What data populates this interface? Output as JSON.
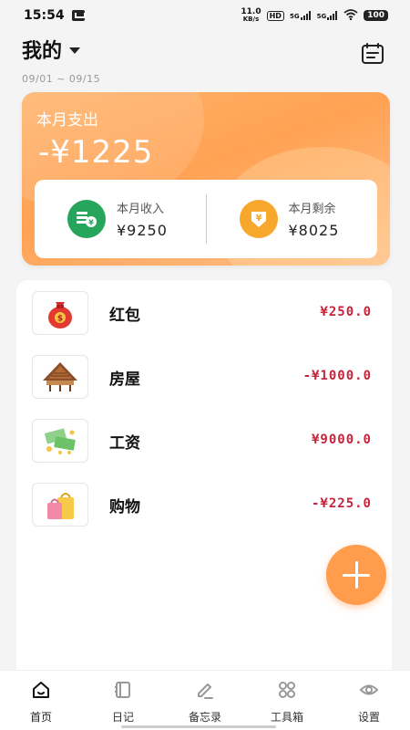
{
  "status_bar": {
    "time": "15:54",
    "network_speed": "11.0",
    "network_unit": "KB/s",
    "hd_badge": "HD",
    "signal1": "5G",
    "signal2": "5G",
    "battery": "100"
  },
  "header": {
    "title": "我的",
    "date_range": "09/01 ~ 09/15",
    "icons": [
      "chevron-down-icon",
      "calendar-icon"
    ]
  },
  "summary": {
    "expense_label": "本月支出",
    "expense_amount": "-¥1225",
    "income_label": "本月收入",
    "income_amount": "¥9250",
    "remaining_label": "本月剩余",
    "remaining_amount": "¥8025",
    "income_icon_glyph": "¥",
    "remaining_icon_glyph": "¥",
    "colors": {
      "card": "#ffa254",
      "income_icon": "#27a55d",
      "remaining_icon": "#f7a72c"
    }
  },
  "records": [
    {
      "name": "红包",
      "amount": "¥250.0",
      "icon": "red-envelope-icon"
    },
    {
      "name": "房屋",
      "amount": "-¥1000.0",
      "icon": "house-icon"
    },
    {
      "name": "工资",
      "amount": "¥9000.0",
      "icon": "money-icon"
    },
    {
      "name": "购物",
      "amount": "-¥225.0",
      "icon": "shopping-bag-icon"
    }
  ],
  "amount_color": "#c5243c",
  "fab": {
    "icon": "plus-icon",
    "color": "#ff9d4d"
  },
  "bottom_nav": [
    {
      "label": "首页",
      "icon": "home-icon",
      "active": true
    },
    {
      "label": "日记",
      "icon": "diary-icon",
      "active": false
    },
    {
      "label": "备忘录",
      "icon": "memo-icon",
      "active": false
    },
    {
      "label": "工具箱",
      "icon": "toolbox-icon",
      "active": false
    },
    {
      "label": "设置",
      "icon": "settings-icon",
      "active": false
    }
  ]
}
